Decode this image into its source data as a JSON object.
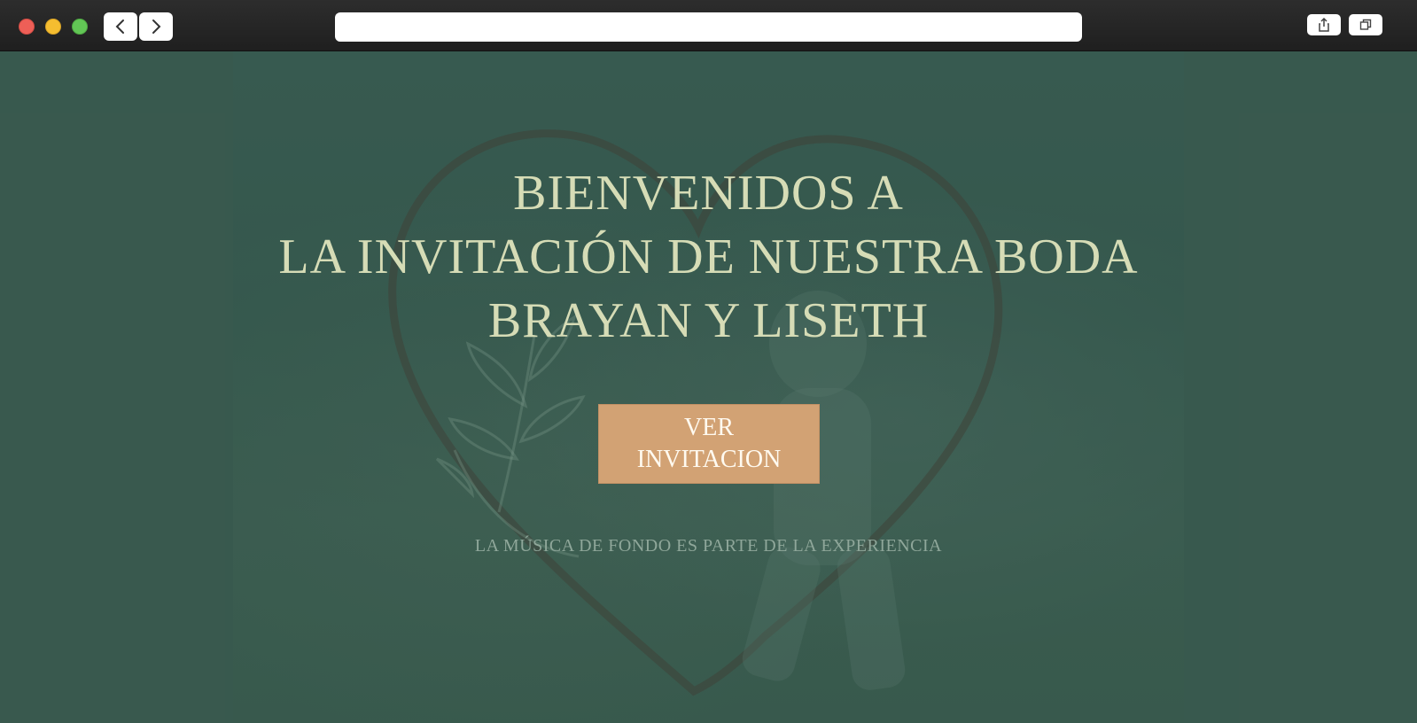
{
  "browser": {
    "url_text": "",
    "icons": {
      "back": "chevron-left-icon",
      "forward": "chevron-right-icon",
      "share": "share-icon",
      "tabs": "tabs-icon"
    }
  },
  "hero": {
    "line1": "BIENVENIDOS A",
    "line2": "LA INVITACIÓN DE NUESTRA BODA",
    "line3": "BRAYAN Y LISETH",
    "button_label": "VER INVITACION",
    "note": "LA MÚSICA DE FONDO ES PARTE DE LA EXPERIENCIA"
  },
  "colors": {
    "background": "#3b5a4f",
    "headline": "#d6dcb6",
    "button": "#d2a274",
    "note": "#8fa79a"
  }
}
